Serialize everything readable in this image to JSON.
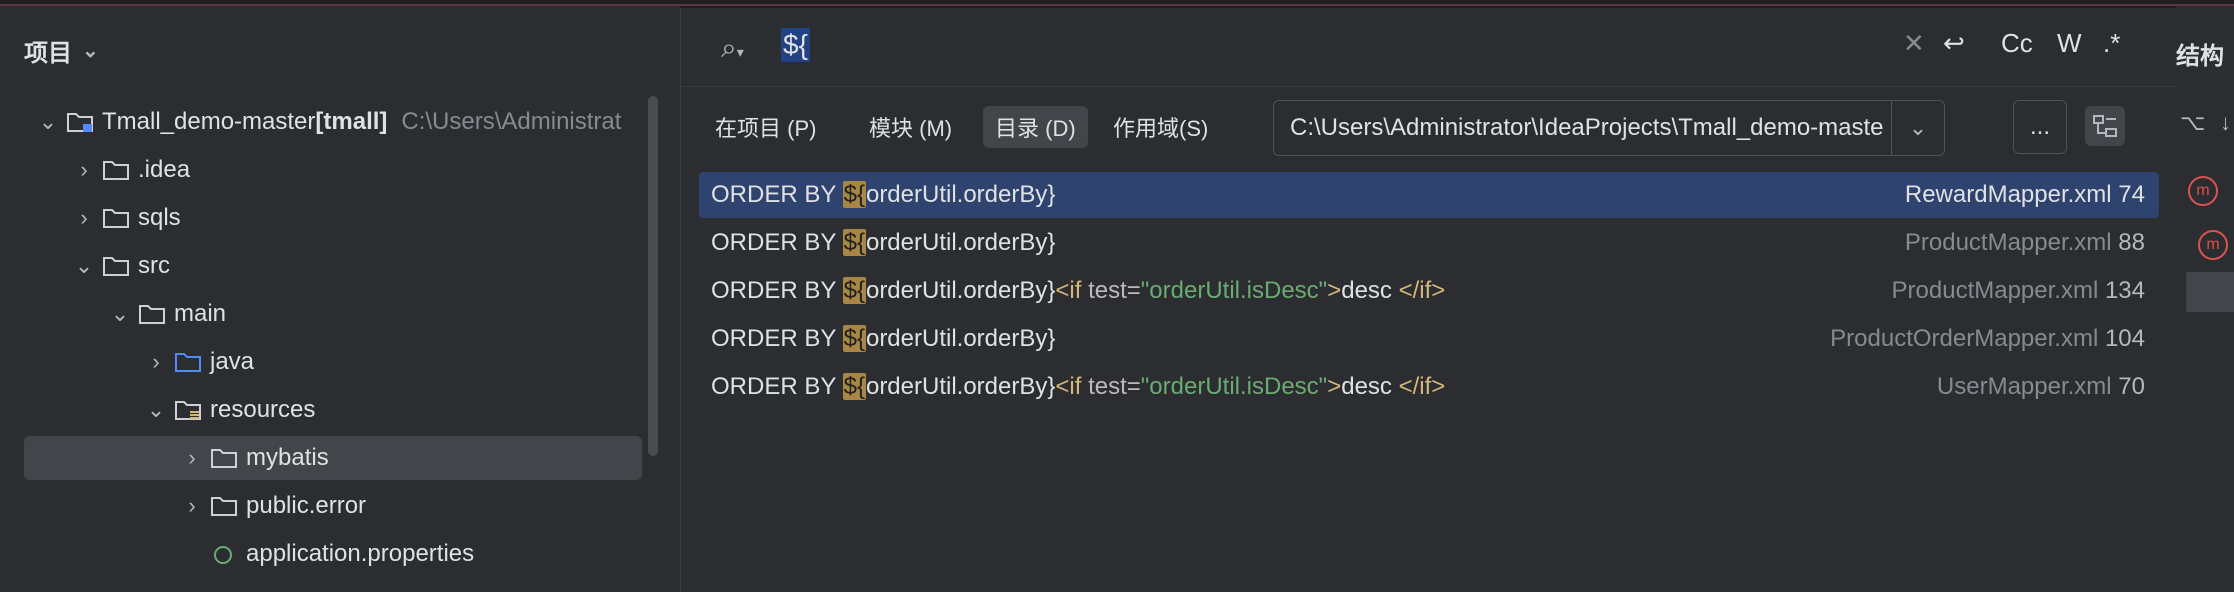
{
  "project_panel": {
    "title": "项目",
    "tree": [
      {
        "level": 0,
        "arrow": "expanded",
        "name": "Tmall_demo-master",
        "suffix": "[tmall]",
        "path": "C:\\Users\\Administrat",
        "icon": "module-folder-icon"
      },
      {
        "level": 1,
        "arrow": "collapsed",
        "name": ".idea",
        "icon": "folder-icon"
      },
      {
        "level": 1,
        "arrow": "collapsed",
        "name": "sqls",
        "icon": "folder-icon"
      },
      {
        "level": 1,
        "arrow": "expanded",
        "name": "src",
        "icon": "folder-icon"
      },
      {
        "level": 2,
        "arrow": "expanded",
        "name": "main",
        "icon": "folder-icon"
      },
      {
        "level": 3,
        "arrow": "collapsed",
        "name": "java",
        "icon": "source-folder-icon"
      },
      {
        "level": 3,
        "arrow": "expanded",
        "name": "resources",
        "icon": "resources-folder-icon"
      },
      {
        "level": 4,
        "arrow": "collapsed",
        "name": "mybatis",
        "icon": "folder-icon",
        "selected": true
      },
      {
        "level": 4,
        "arrow": "collapsed",
        "name": "public.error",
        "icon": "folder-icon"
      },
      {
        "level": 4,
        "arrow": "none",
        "name": "application.properties",
        "icon": "spring-properties-icon"
      }
    ]
  },
  "right_strip": {
    "label": "结构"
  },
  "find_popup": {
    "search_query": "${",
    "options": [
      "Cc",
      "W",
      ".*"
    ],
    "scopes": [
      {
        "label": "在项目 (P)",
        "active": false
      },
      {
        "label": "模块 (M)",
        "active": false
      },
      {
        "label": "目录 (D)",
        "active": true
      },
      {
        "label": "作用域(S)",
        "active": false
      }
    ],
    "directory": "C:\\Users\\Administrator\\IdeaProjects\\Tmall_demo-maste",
    "browse_label": "...",
    "results": [
      {
        "prefix": "ORDER BY ",
        "match": "${",
        "rest": "orderUtil.orderBy}",
        "if_test": false,
        "file": "RewardMapper.xml",
        "line": "74",
        "selected": true
      },
      {
        "prefix": "ORDER BY ",
        "match": "${",
        "rest": "orderUtil.orderBy}",
        "if_test": false,
        "file": "ProductMapper.xml",
        "line": "88",
        "selected": false
      },
      {
        "prefix": "ORDER BY ",
        "match": "${",
        "rest": "orderUtil.orderBy}",
        "if_test": true,
        "tag_open": "<if",
        "attr": " test=",
        "value": "\"orderUtil.isDesc\"",
        "close": ">",
        "body": "desc ",
        "end_tag": "</if>",
        "file": "ProductMapper.xml",
        "line": "134",
        "selected": false
      },
      {
        "prefix": "ORDER BY ",
        "match": "${",
        "rest": "orderUtil.orderBy}",
        "if_test": false,
        "file": "ProductOrderMapper.xml",
        "line": "104",
        "selected": false
      },
      {
        "prefix": "ORDER BY ",
        "match": "${",
        "rest": "orderUtil.orderBy}",
        "if_test": true,
        "tag_open": "<if",
        "attr": " test=",
        "value": "\"orderUtil.isDesc\"",
        "close": ">",
        "body": "desc ",
        "end_tag": "</if>",
        "file": "UserMapper.xml",
        "line": "70",
        "selected": false
      }
    ]
  }
}
